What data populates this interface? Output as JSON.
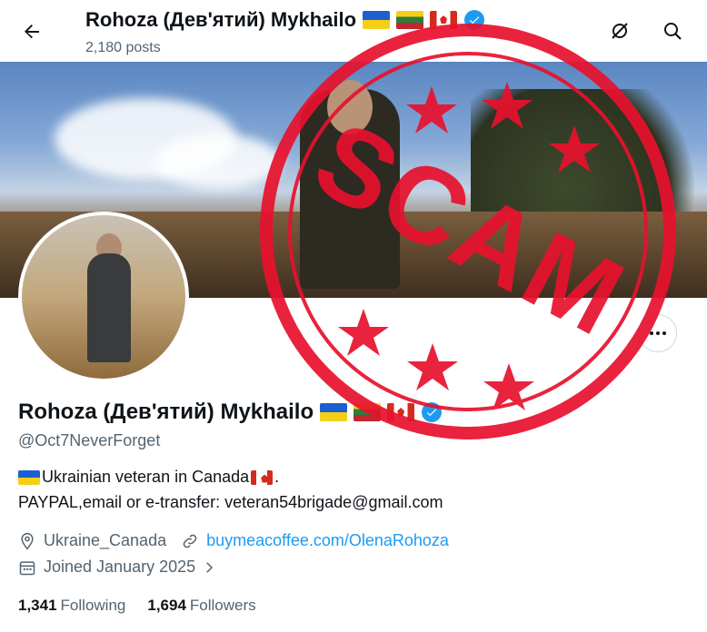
{
  "header": {
    "title": "Rohoza (Дев'ятий) Mykhailo",
    "posts": "2,180 posts",
    "back_icon": "arrow-left-icon",
    "icons": [
      "unfollow-sync-icon",
      "search-icon"
    ]
  },
  "profile": {
    "name": "Rohoza (Дев'ятий) Mykhailo",
    "handle": "@Oct7NeverForget",
    "bio_line1": "Ukrainian veteran in Canada",
    "bio_line1_end": ".",
    "bio_line2": "PAYPAL,email or e-transfer: veteran54brigade@gmail.com",
    "location": "Ukraine_Canada",
    "website": "buymeacoffee.com/OlenaRohoza",
    "joined": "Joined January 2025",
    "following_count": "1,341",
    "following_label": "Following",
    "followers_count": "1,694",
    "followers_label": "Followers"
  },
  "overlay": {
    "stamp_text": "SCAM",
    "stamp_color": "#e8112d"
  },
  "colors": {
    "link": "#1d9bf0",
    "muted": "#536471",
    "text": "#0f1419"
  }
}
